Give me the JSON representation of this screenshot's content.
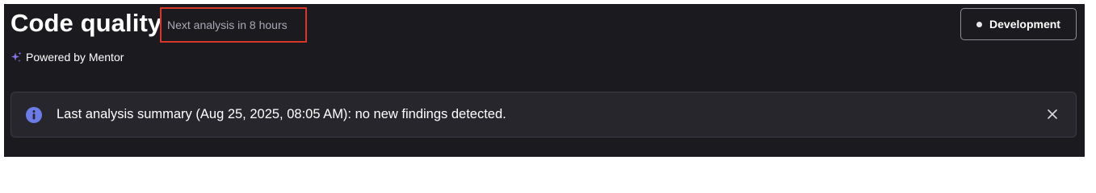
{
  "header": {
    "title": "Code quality",
    "next_analysis": "Next analysis in 8 hours",
    "powered_by": "Powered by Mentor"
  },
  "environment_button": {
    "label": "Development"
  },
  "banner": {
    "message": "Last analysis summary (Aug 25, 2025, 08:05 AM): no new findings detected.",
    "icon": "info-icon",
    "dismiss_icon": "close-icon"
  },
  "colors": {
    "panel_background": "#1b1b1f",
    "banner_background": "#26262c",
    "info_icon": "#6b7ce8",
    "sparkle_icon": "#8a73e6",
    "highlight_border": "#d7372b",
    "muted_text": "#a9a9b5"
  }
}
